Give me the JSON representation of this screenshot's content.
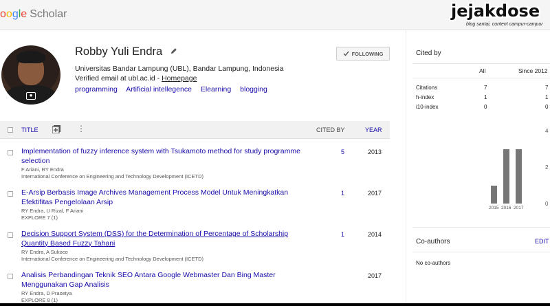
{
  "header": {
    "logo_letters": [
      "o",
      "o",
      "g",
      "l",
      "e"
    ],
    "logo_text": "Scholar",
    "watermark": "jejakdose",
    "watermark_tagline": "blog santai, content campur-campur"
  },
  "profile": {
    "name": "Robby Yuli Endra",
    "affiliation": "Universitas Bandar Lampung (UBL), Bandar Lampung, Indonesia",
    "email_text": "Verified email at ubl.ac.id - ",
    "homepage": "Homepage",
    "interests": [
      "programming",
      "Artificial intellegence",
      "Elearning",
      "blogging"
    ],
    "follow_label": "FOLLOWING"
  },
  "table": {
    "title_header": "TITLE",
    "cited_header": "CITED BY",
    "year_header": "YEAR",
    "rows": [
      {
        "title": "Implementation of fuzzy inference system with Tsukamoto method for study programme selection",
        "authors": "F Ariani, RY Endra",
        "venue": "International Conference on Engineering and Technology Development (ICETD)",
        "cited": "5",
        "year": "2013"
      },
      {
        "title": "E-Arsip Berbasis Image Archives Management Process Model Untuk Meningkatkan Efektifitas Pengelolaan Arsip",
        "authors": "RY Endra, U Rizal, F Ariani",
        "venue": "EXPLORE 7 (1)",
        "cited": "1",
        "year": "2017"
      },
      {
        "title": "Decision Support System (DSS) for the Determination of Percentage of Scholarship Quantity Based Fuzzy Tahani",
        "authors": "RY Endra, A Sukoco",
        "venue": "International Conference on Engineering and Technology Development (ICETD)",
        "cited": "1",
        "year": "2014"
      },
      {
        "title": "Analisis Perbandingan Teknik SEO Antara Google Webmaster Dan Bing Master Menggunakan Gap Analisis",
        "authors": "RY Endra, D Prasetya",
        "venue": "EXPLORE 8 (1)",
        "cited": "",
        "year": "2017"
      }
    ]
  },
  "cited_by": {
    "title": "Cited by",
    "col_all": "All",
    "col_since": "Since 2012",
    "metrics": [
      {
        "label": "Citations",
        "all": "7",
        "since": "7"
      },
      {
        "label": "h-index",
        "all": "1",
        "since": "1"
      },
      {
        "label": "i10-index",
        "all": "0",
        "since": "0"
      }
    ]
  },
  "chart_data": {
    "type": "bar",
    "categories": [
      "2015",
      "2016",
      "2017"
    ],
    "values": [
      1,
      3,
      3
    ],
    "ylim": [
      0,
      4
    ],
    "yticks": [
      "4",
      "2",
      "0"
    ]
  },
  "coauthors": {
    "title": "Co-authors",
    "edit_label": "EDIT",
    "empty": "No co-authors"
  },
  "colors": {
    "link": "#1a0dab",
    "bar": "#777777",
    "header_bg": "#f5f5f5"
  }
}
